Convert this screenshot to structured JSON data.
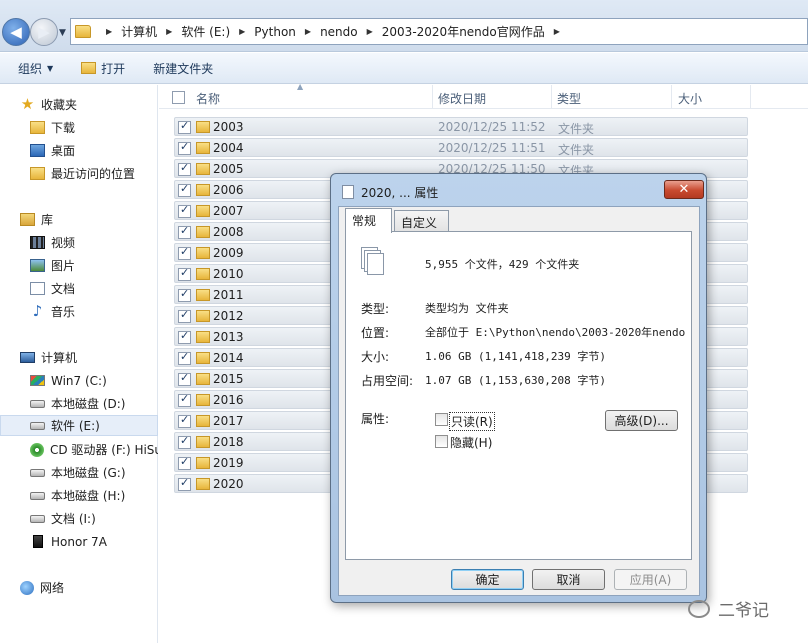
{
  "address": {
    "crumbs": [
      "计算机",
      "软件 (E:)",
      "Python",
      "nendo",
      "2003-2020年nendo官网作品"
    ]
  },
  "toolbar": {
    "organize": "组织",
    "open": "打开",
    "new_folder": "新建文件夹"
  },
  "sidebar": {
    "favorites": "收藏夹",
    "downloads": "下载",
    "desktop": "桌面",
    "recent": "最近访问的位置",
    "libraries": "库",
    "videos": "视频",
    "pictures": "图片",
    "documents": "文档",
    "music": "音乐",
    "computer": "计算机",
    "drive_c": "Win7 (C:)",
    "drive_d": "本地磁盘 (D:)",
    "drive_e": "软件 (E:)",
    "drive_f": "CD 驱动器 (F:) HiSu",
    "drive_g": "本地磁盘 (G:)",
    "drive_h": "本地磁盘 (H:)",
    "drive_i": "文档 (I:)",
    "honor": "Honor 7A",
    "network": "网络"
  },
  "columns": {
    "name": "名称",
    "modified": "修改日期",
    "type": "类型",
    "size": "大小"
  },
  "rows": [
    {
      "name": "2003",
      "date": "2020/12/25 11:52",
      "type": "文件夹"
    },
    {
      "name": "2004",
      "date": "2020/12/25 11:51",
      "type": "文件夹"
    },
    {
      "name": "2005",
      "date": "2020/12/25 11:50",
      "type": "文件夹"
    },
    {
      "name": "2006",
      "date": "",
      "type": ""
    },
    {
      "name": "2007",
      "date": "",
      "type": ""
    },
    {
      "name": "2008",
      "date": "",
      "type": ""
    },
    {
      "name": "2009",
      "date": "",
      "type": ""
    },
    {
      "name": "2010",
      "date": "",
      "type": ""
    },
    {
      "name": "2011",
      "date": "",
      "type": ""
    },
    {
      "name": "2012",
      "date": "",
      "type": ""
    },
    {
      "name": "2013",
      "date": "",
      "type": ""
    },
    {
      "name": "2014",
      "date": "",
      "type": ""
    },
    {
      "name": "2015",
      "date": "",
      "type": ""
    },
    {
      "name": "2016",
      "date": "",
      "type": ""
    },
    {
      "name": "2017",
      "date": "",
      "type": ""
    },
    {
      "name": "2018",
      "date": "",
      "type": ""
    },
    {
      "name": "2019",
      "date": "",
      "type": ""
    },
    {
      "name": "2020",
      "date": "",
      "type": ""
    }
  ],
  "dialog": {
    "title": "2020, ... 属性",
    "close": "✕",
    "tab_general": "常规",
    "tab_custom": "自定义",
    "summary": "5,955 个文件，429 个文件夹",
    "type_label": "类型:",
    "type_value": "类型均为 文件夹",
    "location_label": "位置:",
    "location_value": "全部位于 E:\\Python\\nendo\\2003-2020年nendo",
    "size_label": "大小:",
    "size_value": "1.06 GB (1,141,418,239 字节)",
    "disk_label": "占用空间:",
    "disk_value": "1.07 GB (1,153,630,208 字节)",
    "attr_label": "属性:",
    "readonly": "只读(R)",
    "hidden": "隐藏(H)",
    "advanced": "高级(D)...",
    "ok": "确定",
    "cancel": "取消",
    "apply": "应用(A)"
  },
  "watermark": "二爷记"
}
